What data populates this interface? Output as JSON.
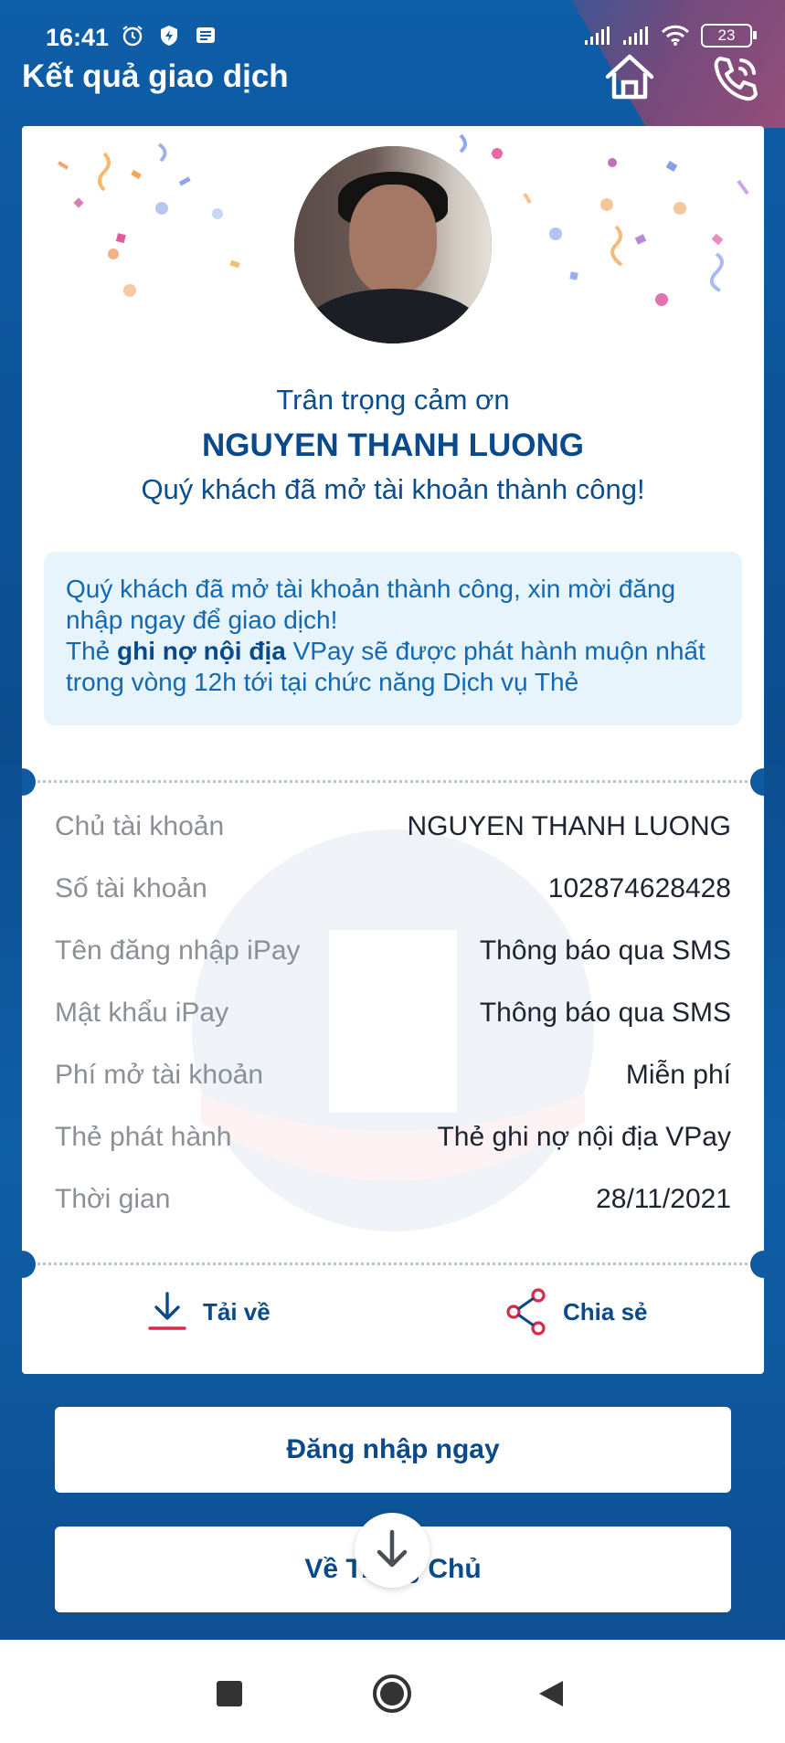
{
  "status_bar": {
    "time": "16:41",
    "battery": "23"
  },
  "header": {
    "title": "Kết quả giao dịch"
  },
  "result": {
    "thanks": "Trân trọng cảm ơn",
    "customer_name": "NGUYEN THANH LUONG",
    "subtitle": "Quý khách đã mở tài khoản thành công!"
  },
  "notice": {
    "line1": "Quý khách đã mở tài khoản thành công, xin mời đăng nhập ngay để giao dịch!",
    "line2_prefix": "Thẻ ",
    "line2_bold": "ghi nợ nội địa",
    "line2_suffix": " VPay sẽ được phát hành muộn nhất trong vòng 12h tới tại chức năng Dịch vụ Thẻ"
  },
  "details": [
    {
      "label": "Chủ tài khoản",
      "value": "NGUYEN THANH LUONG"
    },
    {
      "label": "Số tài khoản",
      "value": "102874628428"
    },
    {
      "label": "Tên đăng nhập iPay",
      "value": "Thông báo qua SMS"
    },
    {
      "label": "Mật khẩu iPay",
      "value": "Thông báo qua SMS"
    },
    {
      "label": "Phí mở tài khoản",
      "value": "Miễn phí"
    },
    {
      "label": "Thẻ phát hành",
      "value": "Thẻ ghi nợ nội địa VPay"
    },
    {
      "label": "Thời gian",
      "value": "28/11/2021"
    }
  ],
  "actions": {
    "download": "Tải về",
    "share": "Chia sẻ"
  },
  "buttons": {
    "login": "Đăng nhập ngay",
    "home": "Về Trang Chủ"
  },
  "colors": {
    "primary": "#0a4a8a",
    "background": "#0e5ea8",
    "accent": "#d9284a",
    "notice_bg": "#e8f4fc"
  }
}
